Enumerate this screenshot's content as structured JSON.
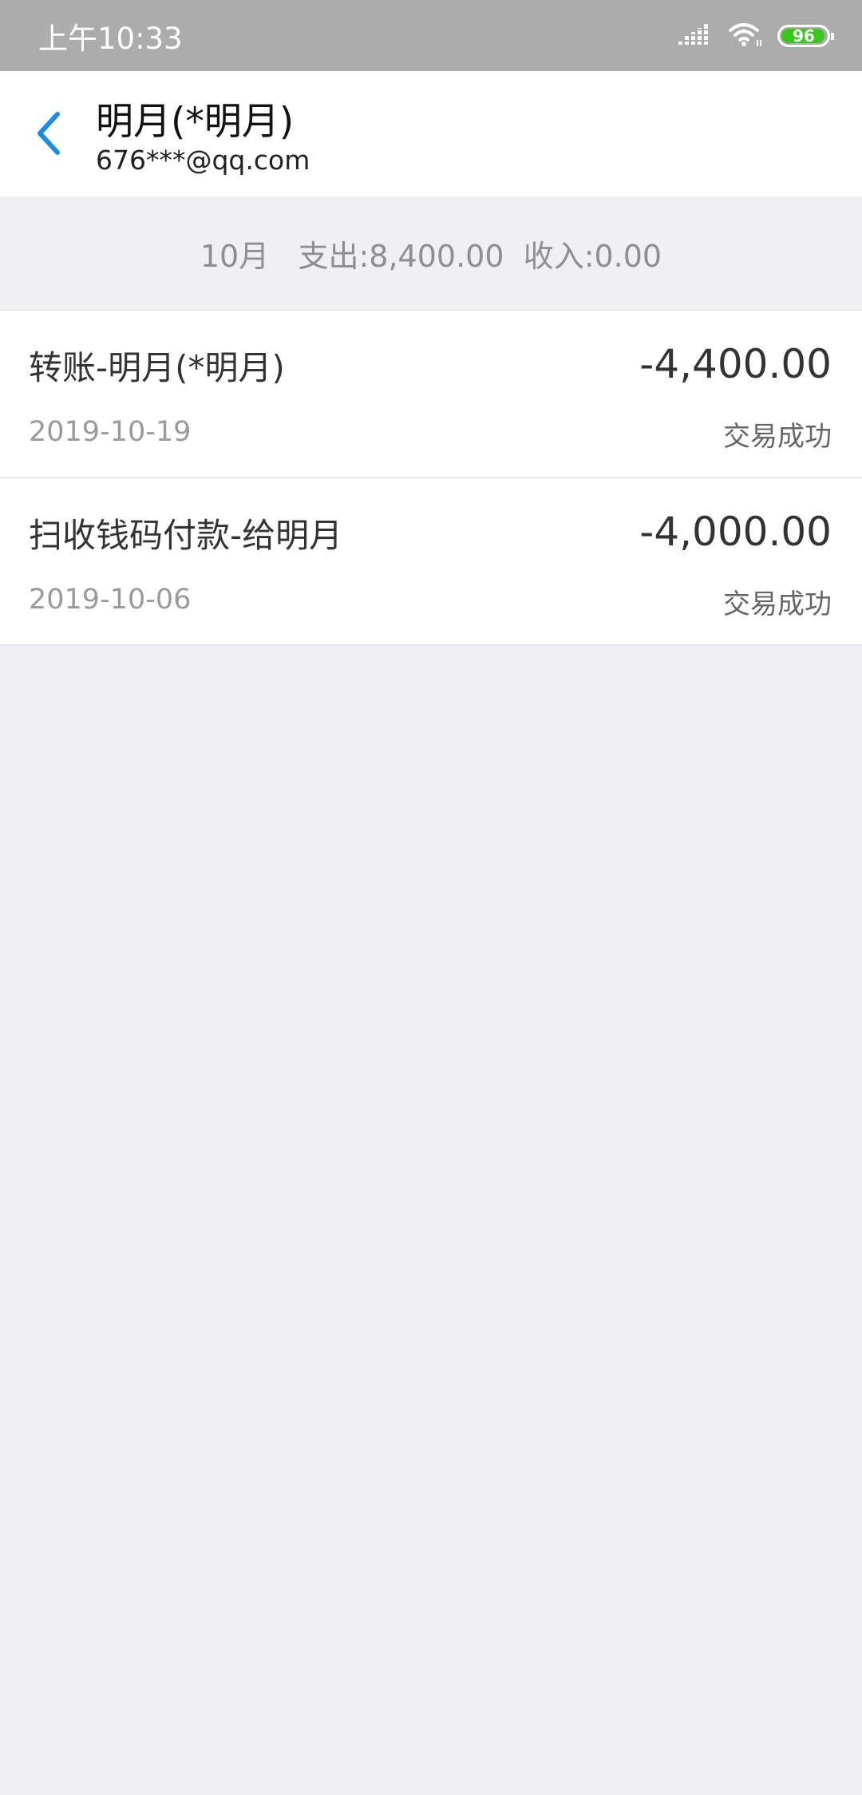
{
  "status_bar": {
    "time": "上午10:33",
    "battery_level": "96",
    "battery_percent": 0.96,
    "icons": [
      "signal-icon",
      "wifi-icon",
      "battery-icon"
    ],
    "battery_color": "#3cc51f"
  },
  "header": {
    "title": "明月(*明月)",
    "subtitle": "676***@qq.com",
    "back_icon": "chevron-left-icon",
    "accent_color": "#1a8be6"
  },
  "summary": {
    "month": "10月",
    "expense": "支出:8,400.00",
    "income": "收入:0.00"
  },
  "transactions": [
    {
      "title": "转账-明月(*明月)",
      "amount": "-4,400.00",
      "date": "2019-10-19",
      "status": "交易成功"
    },
    {
      "title": "扫收钱码付款-给明月",
      "amount": "-4,000.00",
      "date": "2019-10-06",
      "status": "交易成功"
    }
  ]
}
